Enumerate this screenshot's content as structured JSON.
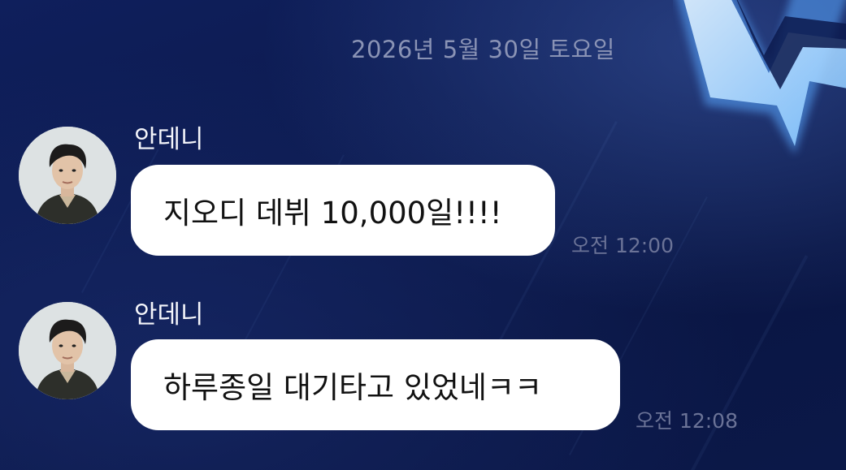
{
  "chat": {
    "date_divider": "2026년 5월 30일 토요일",
    "messages": [
      {
        "sender": "안데니",
        "avatar_icon": "profile-photo-avatar",
        "text": "지오디 데뷔 10,000일!!!!",
        "time": "오전 12:00"
      },
      {
        "sender": "안데니",
        "avatar_icon": "profile-photo-avatar",
        "text": "하루종일 대기타고 있었네ㅋㅋ",
        "time": "오전 12:08"
      }
    ]
  },
  "colors": {
    "background": "#0c1a4e",
    "bubble": "#ffffff",
    "date_text": "#8a93b5",
    "time_text": "#6b7397",
    "logo_glow": "#bfe3ff"
  }
}
